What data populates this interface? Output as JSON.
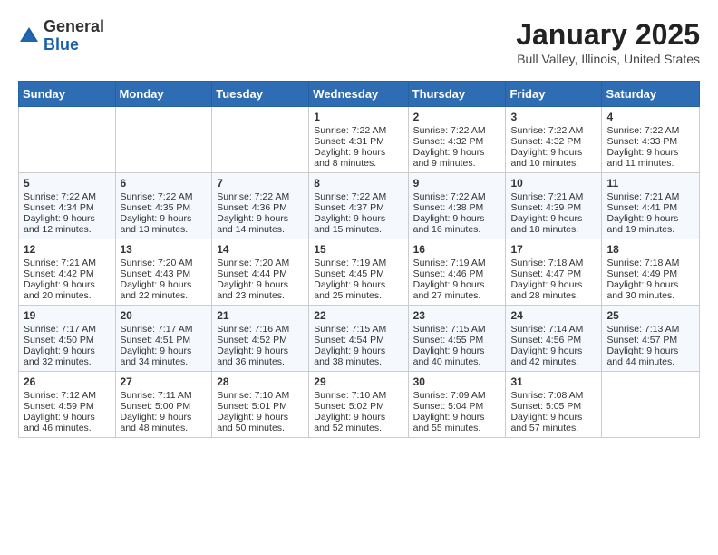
{
  "logo": {
    "general": "General",
    "blue": "Blue"
  },
  "header": {
    "title": "January 2025",
    "location": "Bull Valley, Illinois, United States"
  },
  "days_of_week": [
    "Sunday",
    "Monday",
    "Tuesday",
    "Wednesday",
    "Thursday",
    "Friday",
    "Saturday"
  ],
  "weeks": [
    [
      {
        "day": "",
        "sunrise": "",
        "sunset": "",
        "daylight": ""
      },
      {
        "day": "",
        "sunrise": "",
        "sunset": "",
        "daylight": ""
      },
      {
        "day": "",
        "sunrise": "",
        "sunset": "",
        "daylight": ""
      },
      {
        "day": "1",
        "sunrise": "Sunrise: 7:22 AM",
        "sunset": "Sunset: 4:31 PM",
        "daylight": "Daylight: 9 hours and 8 minutes."
      },
      {
        "day": "2",
        "sunrise": "Sunrise: 7:22 AM",
        "sunset": "Sunset: 4:32 PM",
        "daylight": "Daylight: 9 hours and 9 minutes."
      },
      {
        "day": "3",
        "sunrise": "Sunrise: 7:22 AM",
        "sunset": "Sunset: 4:32 PM",
        "daylight": "Daylight: 9 hours and 10 minutes."
      },
      {
        "day": "4",
        "sunrise": "Sunrise: 7:22 AM",
        "sunset": "Sunset: 4:33 PM",
        "daylight": "Daylight: 9 hours and 11 minutes."
      }
    ],
    [
      {
        "day": "5",
        "sunrise": "Sunrise: 7:22 AM",
        "sunset": "Sunset: 4:34 PM",
        "daylight": "Daylight: 9 hours and 12 minutes."
      },
      {
        "day": "6",
        "sunrise": "Sunrise: 7:22 AM",
        "sunset": "Sunset: 4:35 PM",
        "daylight": "Daylight: 9 hours and 13 minutes."
      },
      {
        "day": "7",
        "sunrise": "Sunrise: 7:22 AM",
        "sunset": "Sunset: 4:36 PM",
        "daylight": "Daylight: 9 hours and 14 minutes."
      },
      {
        "day": "8",
        "sunrise": "Sunrise: 7:22 AM",
        "sunset": "Sunset: 4:37 PM",
        "daylight": "Daylight: 9 hours and 15 minutes."
      },
      {
        "day": "9",
        "sunrise": "Sunrise: 7:22 AM",
        "sunset": "Sunset: 4:38 PM",
        "daylight": "Daylight: 9 hours and 16 minutes."
      },
      {
        "day": "10",
        "sunrise": "Sunrise: 7:21 AM",
        "sunset": "Sunset: 4:39 PM",
        "daylight": "Daylight: 9 hours and 18 minutes."
      },
      {
        "day": "11",
        "sunrise": "Sunrise: 7:21 AM",
        "sunset": "Sunset: 4:41 PM",
        "daylight": "Daylight: 9 hours and 19 minutes."
      }
    ],
    [
      {
        "day": "12",
        "sunrise": "Sunrise: 7:21 AM",
        "sunset": "Sunset: 4:42 PM",
        "daylight": "Daylight: 9 hours and 20 minutes."
      },
      {
        "day": "13",
        "sunrise": "Sunrise: 7:20 AM",
        "sunset": "Sunset: 4:43 PM",
        "daylight": "Daylight: 9 hours and 22 minutes."
      },
      {
        "day": "14",
        "sunrise": "Sunrise: 7:20 AM",
        "sunset": "Sunset: 4:44 PM",
        "daylight": "Daylight: 9 hours and 23 minutes."
      },
      {
        "day": "15",
        "sunrise": "Sunrise: 7:19 AM",
        "sunset": "Sunset: 4:45 PM",
        "daylight": "Daylight: 9 hours and 25 minutes."
      },
      {
        "day": "16",
        "sunrise": "Sunrise: 7:19 AM",
        "sunset": "Sunset: 4:46 PM",
        "daylight": "Daylight: 9 hours and 27 minutes."
      },
      {
        "day": "17",
        "sunrise": "Sunrise: 7:18 AM",
        "sunset": "Sunset: 4:47 PM",
        "daylight": "Daylight: 9 hours and 28 minutes."
      },
      {
        "day": "18",
        "sunrise": "Sunrise: 7:18 AM",
        "sunset": "Sunset: 4:49 PM",
        "daylight": "Daylight: 9 hours and 30 minutes."
      }
    ],
    [
      {
        "day": "19",
        "sunrise": "Sunrise: 7:17 AM",
        "sunset": "Sunset: 4:50 PM",
        "daylight": "Daylight: 9 hours and 32 minutes."
      },
      {
        "day": "20",
        "sunrise": "Sunrise: 7:17 AM",
        "sunset": "Sunset: 4:51 PM",
        "daylight": "Daylight: 9 hours and 34 minutes."
      },
      {
        "day": "21",
        "sunrise": "Sunrise: 7:16 AM",
        "sunset": "Sunset: 4:52 PM",
        "daylight": "Daylight: 9 hours and 36 minutes."
      },
      {
        "day": "22",
        "sunrise": "Sunrise: 7:15 AM",
        "sunset": "Sunset: 4:54 PM",
        "daylight": "Daylight: 9 hours and 38 minutes."
      },
      {
        "day": "23",
        "sunrise": "Sunrise: 7:15 AM",
        "sunset": "Sunset: 4:55 PM",
        "daylight": "Daylight: 9 hours and 40 minutes."
      },
      {
        "day": "24",
        "sunrise": "Sunrise: 7:14 AM",
        "sunset": "Sunset: 4:56 PM",
        "daylight": "Daylight: 9 hours and 42 minutes."
      },
      {
        "day": "25",
        "sunrise": "Sunrise: 7:13 AM",
        "sunset": "Sunset: 4:57 PM",
        "daylight": "Daylight: 9 hours and 44 minutes."
      }
    ],
    [
      {
        "day": "26",
        "sunrise": "Sunrise: 7:12 AM",
        "sunset": "Sunset: 4:59 PM",
        "daylight": "Daylight: 9 hours and 46 minutes."
      },
      {
        "day": "27",
        "sunrise": "Sunrise: 7:11 AM",
        "sunset": "Sunset: 5:00 PM",
        "daylight": "Daylight: 9 hours and 48 minutes."
      },
      {
        "day": "28",
        "sunrise": "Sunrise: 7:10 AM",
        "sunset": "Sunset: 5:01 PM",
        "daylight": "Daylight: 9 hours and 50 minutes."
      },
      {
        "day": "29",
        "sunrise": "Sunrise: 7:10 AM",
        "sunset": "Sunset: 5:02 PM",
        "daylight": "Daylight: 9 hours and 52 minutes."
      },
      {
        "day": "30",
        "sunrise": "Sunrise: 7:09 AM",
        "sunset": "Sunset: 5:04 PM",
        "daylight": "Daylight: 9 hours and 55 minutes."
      },
      {
        "day": "31",
        "sunrise": "Sunrise: 7:08 AM",
        "sunset": "Sunset: 5:05 PM",
        "daylight": "Daylight: 9 hours and 57 minutes."
      },
      {
        "day": "",
        "sunrise": "",
        "sunset": "",
        "daylight": ""
      }
    ]
  ]
}
